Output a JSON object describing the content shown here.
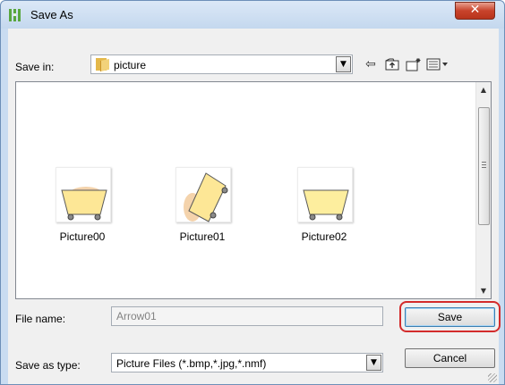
{
  "window": {
    "title": "Save As",
    "close_glyph": "✕"
  },
  "toolbar": {
    "save_in_label": "Save in:",
    "save_in_value": "picture",
    "icons": [
      "folder-icon",
      "back-icon",
      "up-folder-icon",
      "new-folder-icon",
      "view-menu-icon"
    ]
  },
  "files": [
    {
      "name": "Picture00",
      "icon": "cart-thumbnail"
    },
    {
      "name": "Picture01",
      "icon": "cart-thumbnail-tilted"
    },
    {
      "name": "Picture02",
      "icon": "cart-thumbnail"
    }
  ],
  "form": {
    "file_name_label": "File name:",
    "file_name_value": "Arrow01",
    "save_type_label": "Save as type:",
    "save_type_value": "Picture Files (*.bmp,*.jpg,*.nmf)"
  },
  "buttons": {
    "save": "Save",
    "cancel": "Cancel"
  },
  "colors": {
    "highlight": "#d32b2b",
    "title_bar": "#c9dcf1",
    "close_button": "#c8432b"
  }
}
